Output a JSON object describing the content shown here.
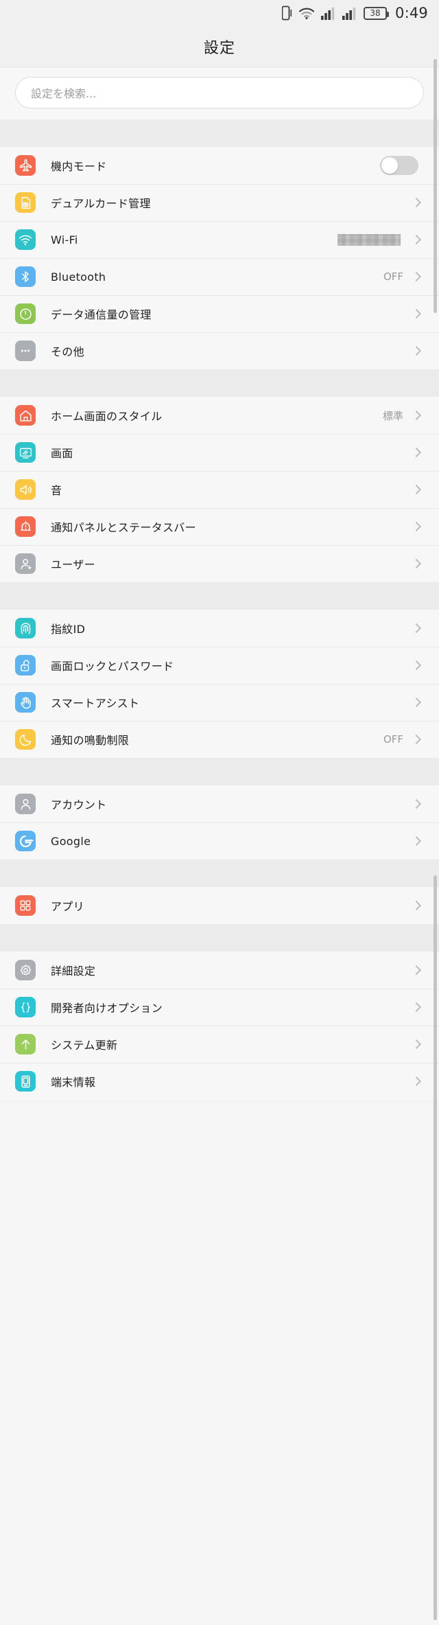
{
  "status_bar": {
    "vibrate_icon": "vibrate-icon",
    "wifi_icon": "wifi-icon",
    "signal1_icon": "signal-bars-icon",
    "signal2_icon": "signal-bars-icon",
    "battery_level": "38",
    "time": "0:49"
  },
  "header": {
    "title": "設定"
  },
  "search": {
    "placeholder": "設定を検索..."
  },
  "colors": {
    "coral": "#F4694E",
    "amber": "#FBC642",
    "teal": "#2EC3C9",
    "blue": "#5CB3F0",
    "green": "#8DC653",
    "gray": "#ABAEB2",
    "cyan": "#2BC4D4",
    "lightgreen": "#9ACD5B",
    "page_bg": "#F7F7F7",
    "gap_bg": "#EBEBEB"
  },
  "groups": [
    {
      "id": "connectivity",
      "rows": [
        {
          "name": "airplane-mode",
          "icon": "airplane-icon",
          "color": "#F4694E",
          "label": "機内モード",
          "control": "toggle",
          "toggle_on": false
        },
        {
          "name": "dual-card",
          "icon": "sim-card-icon",
          "color": "#FBC642",
          "label": "デュアルカード管理",
          "control": "chevron",
          "value": ""
        },
        {
          "name": "wifi",
          "icon": "wifi-icon",
          "color": "#2EC3C9",
          "label": "Wi-Fi",
          "control": "chevron",
          "value": "",
          "redacted": true
        },
        {
          "name": "bluetooth",
          "icon": "bluetooth-icon",
          "color": "#5CB3F0",
          "label": "Bluetooth",
          "control": "chevron",
          "value": "OFF"
        },
        {
          "name": "data-usage",
          "icon": "gauge-icon",
          "color": "#8DC653",
          "label": "データ通信量の管理",
          "control": "chevron",
          "value": ""
        },
        {
          "name": "more",
          "icon": "ellipsis-icon",
          "color": "#ABAEB2",
          "label": "その他",
          "control": "chevron",
          "value": ""
        }
      ]
    },
    {
      "id": "personalization",
      "rows": [
        {
          "name": "home-screen-style",
          "icon": "home-icon",
          "color": "#F4694E",
          "label": "ホーム画面のスタイル",
          "control": "chevron",
          "value": "標準"
        },
        {
          "name": "display",
          "icon": "display-icon",
          "color": "#2EC3C9",
          "label": "画面",
          "control": "chevron",
          "value": ""
        },
        {
          "name": "sound",
          "icon": "speaker-icon",
          "color": "#FBC642",
          "label": "音",
          "control": "chevron",
          "value": ""
        },
        {
          "name": "notification-panel-status-bar",
          "icon": "bell-icon",
          "color": "#F4694E",
          "label": "通知パネルとステータスバー",
          "control": "chevron",
          "value": ""
        },
        {
          "name": "users",
          "icon": "user-add-icon",
          "color": "#ABAEB2",
          "label": "ユーザー",
          "control": "chevron",
          "value": ""
        }
      ]
    },
    {
      "id": "security",
      "rows": [
        {
          "name": "fingerprint-id",
          "icon": "fingerprint-icon",
          "color": "#2EC3C9",
          "label": "指紋ID",
          "control": "chevron",
          "value": ""
        },
        {
          "name": "screen-lock-password",
          "icon": "lock-open-icon",
          "color": "#5CB3F0",
          "label": "画面ロックとパスワード",
          "control": "chevron",
          "value": ""
        },
        {
          "name": "smart-assist",
          "icon": "hand-icon",
          "color": "#5CB3F0",
          "label": "スマートアシスト",
          "control": "chevron",
          "value": ""
        },
        {
          "name": "do-not-disturb",
          "icon": "moon-icon",
          "color": "#FBC642",
          "label": "通知の鳴動制限",
          "control": "chevron",
          "value": "OFF"
        }
      ]
    },
    {
      "id": "accounts",
      "rows": [
        {
          "name": "accounts",
          "icon": "user-icon",
          "color": "#ABAEB2",
          "label": "アカウント",
          "control": "chevron",
          "value": ""
        },
        {
          "name": "google",
          "icon": "google-icon",
          "color": "#5CB3F0",
          "label": "Google",
          "control": "chevron",
          "value": ""
        }
      ]
    },
    {
      "id": "apps",
      "rows": [
        {
          "name": "apps",
          "icon": "grid-icon",
          "color": "#F4694E",
          "label": "アプリ",
          "control": "chevron",
          "value": ""
        }
      ]
    },
    {
      "id": "system",
      "rows": [
        {
          "name": "advanced-settings",
          "icon": "gear-icon",
          "color": "#ABAEB2",
          "label": "詳細設定",
          "control": "chevron",
          "value": ""
        },
        {
          "name": "developer-options",
          "icon": "braces-icon",
          "color": "#2BC4D4",
          "label": "開発者向けオプション",
          "control": "chevron",
          "value": ""
        },
        {
          "name": "system-update",
          "icon": "arrow-up-icon",
          "color": "#9ACD5B",
          "label": "システム更新",
          "control": "chevron",
          "value": ""
        },
        {
          "name": "device-info",
          "icon": "phone-info-icon",
          "color": "#2BC4D4",
          "label": "端末情報",
          "control": "chevron",
          "value": ""
        }
      ]
    }
  ]
}
